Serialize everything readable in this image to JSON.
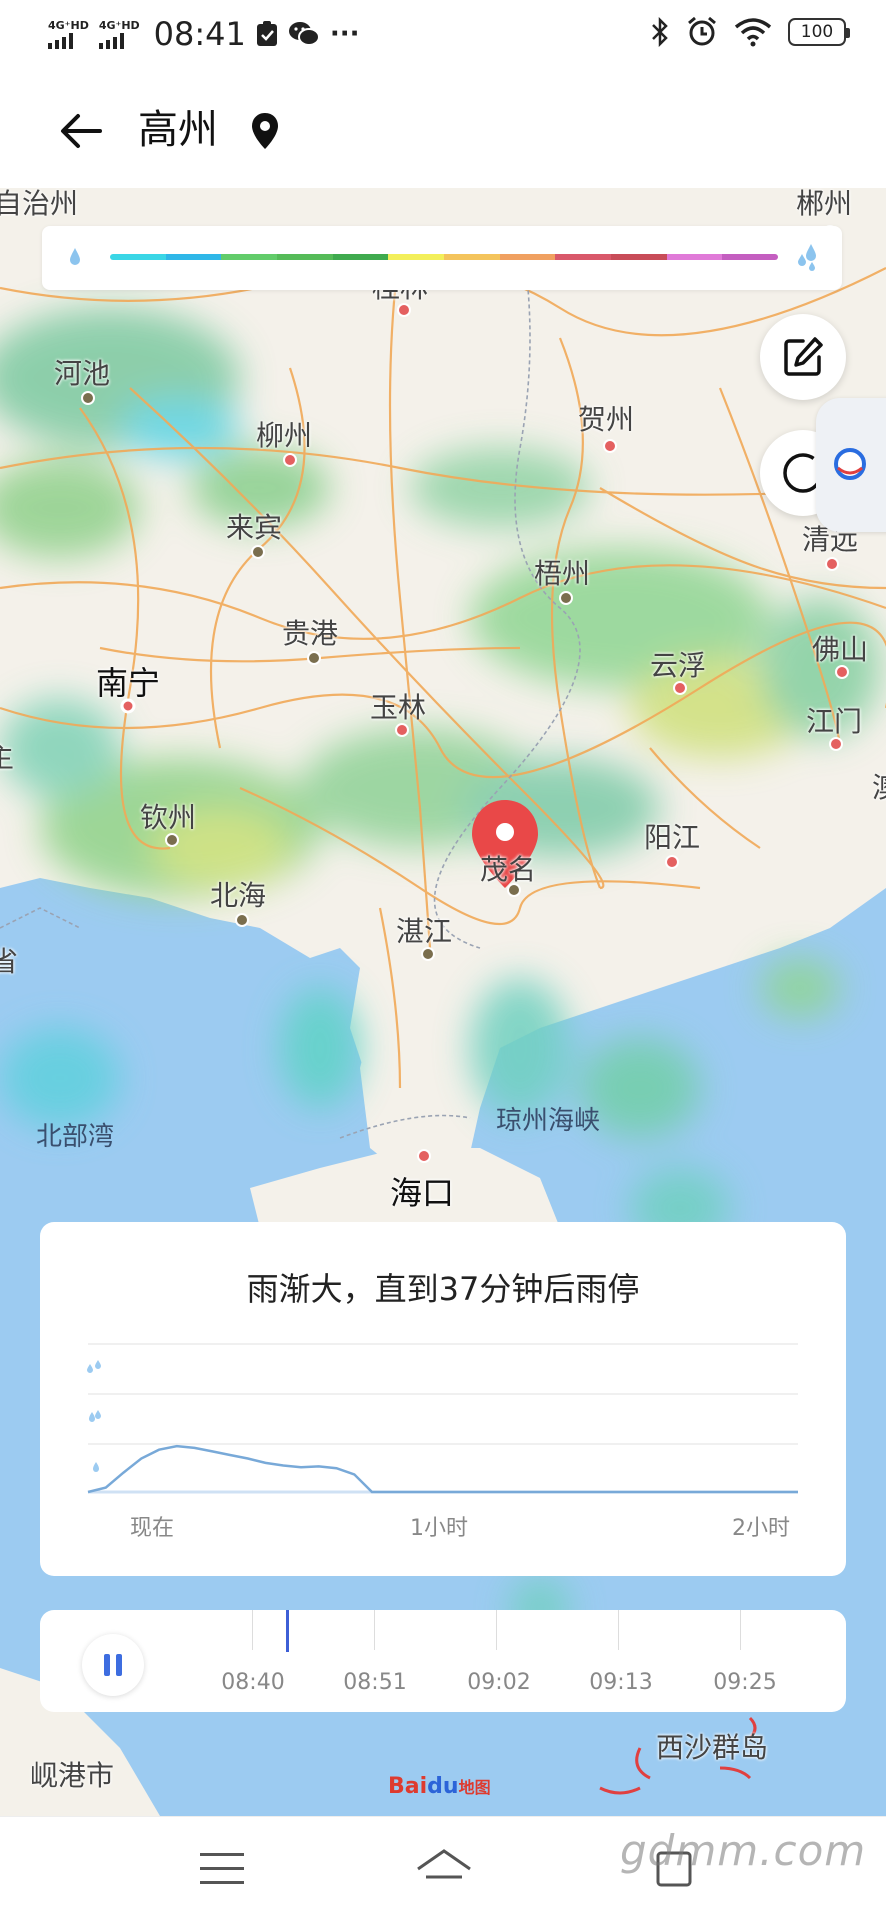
{
  "status_bar": {
    "signal1_label": "4G⁺HD",
    "signal2_label": "4G⁺HD",
    "time": "08:41",
    "overflow": "···",
    "battery": "100"
  },
  "header": {
    "title": "高州"
  },
  "map": {
    "labels": {
      "top_left": "自治州",
      "top_right": "郴州",
      "guilin": "桂林",
      "hechi": "河池",
      "liuzhou": "柳州",
      "hezhou": "贺州",
      "laibin": "来宾",
      "qingyuan": "清远",
      "wuzhou": "梧州",
      "guigang": "贵港",
      "foshan": "佛山",
      "nanning": "南宁",
      "yunfu": "云浮",
      "yulin": "玉林",
      "jiangmen": "江门",
      "qinzhou": "钦州",
      "yangjiang": "阳江",
      "maoming": "茂名",
      "beihai": "北海",
      "zhanjiang": "湛江",
      "beibu_gulf": "北部湾",
      "qiongzhou_strait": "琼州海峡",
      "haikou": "海口",
      "xisha": "西沙群岛",
      "xiangang": "岘港市",
      "edge_left": "主",
      "edge_left2": "省",
      "edge_right": "澳"
    },
    "attribution_bai": "Bai",
    "attribution_du": "du",
    "attribution_map": "地图"
  },
  "legend": {
    "colors": [
      "#3ad6e6",
      "#2fb7e8",
      "#62cc6a",
      "#55bb58",
      "#3faa4e",
      "#f3ef5a",
      "#f4c45c",
      "#f0a060",
      "#d9586a",
      "#c84c58",
      "#e07ad8",
      "#c45ec0"
    ]
  },
  "forecast": {
    "title": "雨渐大，直到37分钟后雨停",
    "axis": [
      "现在",
      "1小时",
      "2小时"
    ],
    "series": [
      0,
      0.05,
      0.22,
      0.38,
      0.48,
      0.52,
      0.5,
      0.46,
      0.42,
      0.38,
      0.33,
      0.3,
      0.28,
      0.29,
      0.27,
      0.2,
      0,
      0,
      0,
      0,
      0,
      0,
      0,
      0,
      0,
      0,
      0,
      0,
      0,
      0,
      0,
      0,
      0,
      0,
      0,
      0,
      0,
      0,
      0,
      0,
      0
    ]
  },
  "timeline": {
    "times": [
      "08:40",
      "08:51",
      "09:02",
      "09:13",
      "09:25"
    ]
  },
  "watermark": "gdmm.com"
}
